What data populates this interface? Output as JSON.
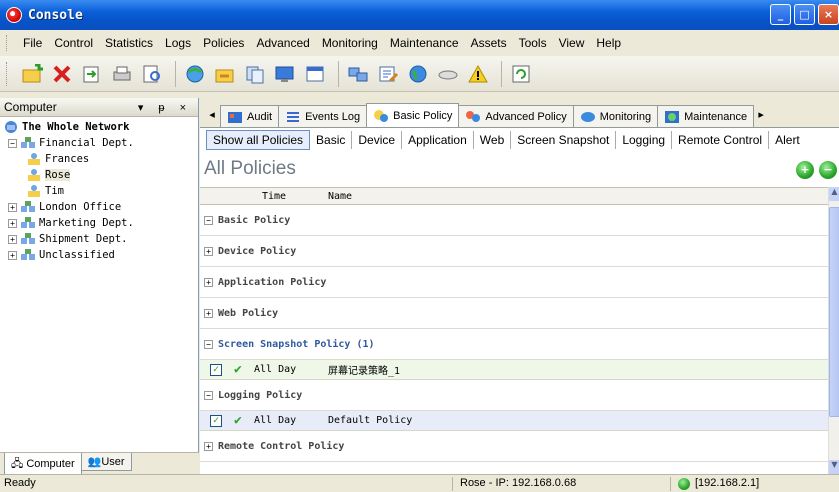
{
  "window": {
    "title": "Console"
  },
  "menu": [
    "File",
    "Control",
    "Statistics",
    "Logs",
    "Policies",
    "Advanced",
    "Monitoring",
    "Maintenance",
    "Assets",
    "Tools",
    "View",
    "Help"
  ],
  "left_panel": {
    "title": "Computer",
    "controls": "▾ ᵽ ×",
    "tree": [
      {
        "label": "The Whole Network"
      },
      {
        "label": "Financial Dept."
      },
      {
        "label": "Frances"
      },
      {
        "label": "Rose"
      },
      {
        "label": "Tim"
      },
      {
        "label": "London Office"
      },
      {
        "label": "Marketing Dept."
      },
      {
        "label": "Shipment Dept."
      },
      {
        "label": "Unclassified"
      }
    ],
    "tabs": [
      "Computer",
      "User"
    ]
  },
  "doc_tabs": [
    "Audit",
    "Events Log",
    "Basic Policy",
    "Advanced Policy",
    "Monitoring",
    "Maintenance"
  ],
  "sub_tabs": [
    "Show all Policies",
    "Basic",
    "Device",
    "Application",
    "Web",
    "Screen Snapshot",
    "Logging",
    "Remote Control",
    "Alert"
  ],
  "page_title": "All Policies",
  "grid": {
    "columns": [
      "Time",
      "Name"
    ],
    "groups": [
      {
        "label": "Basic Policy",
        "expander": "−"
      },
      {
        "label": "Device Policy",
        "expander": "+"
      },
      {
        "label": "Application Policy",
        "expander": "+"
      },
      {
        "label": "Web Policy",
        "expander": "+"
      },
      {
        "label": "Screen Snapshot Policy (1)",
        "expander": "−",
        "row": {
          "time": "All Day",
          "name": "屏幕记录策略_1"
        }
      },
      {
        "label": "Logging Policy",
        "expander": "−",
        "row": {
          "time": "All Day",
          "name": "Default Policy"
        }
      },
      {
        "label": "Remote Control Policy",
        "expander": "+"
      }
    ]
  },
  "status": {
    "left": "Ready",
    "middle": "Rose - IP: 192.168.0.68",
    "right": "[192.168.2.1]"
  },
  "colors": {
    "title_bar": "#0753c8",
    "active_group": "#2f5a9e",
    "check_green": "#2aa52a"
  }
}
